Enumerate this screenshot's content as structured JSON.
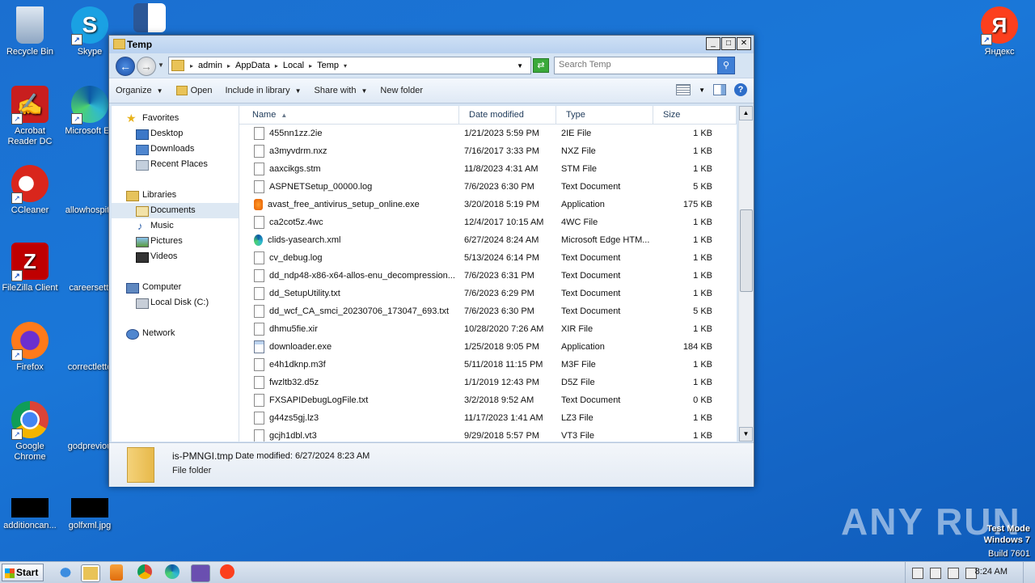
{
  "desktop": {
    "icons": [
      {
        "label": "Recycle Bin"
      },
      {
        "label": "Skype"
      },
      {
        "label": "Acrobat Reader DC"
      },
      {
        "label": "Microsoft Ed"
      },
      {
        "label": "CCleaner"
      },
      {
        "label": "allowhospita"
      },
      {
        "label": "FileZilla Client"
      },
      {
        "label": "careersetti"
      },
      {
        "label": "Firefox"
      },
      {
        "label": "correctlette"
      },
      {
        "label": "Google Chrome"
      },
      {
        "label": "godpreviou"
      },
      {
        "label": "additioncan..."
      },
      {
        "label": "golfxml.jpg"
      },
      {
        "label": "Яндекс"
      }
    ],
    "watermark": {
      "line1": "Test Mode",
      "line2": "Windows 7",
      "line3": "Build 7601"
    },
    "anyrun": "ANY RUN"
  },
  "window": {
    "title": "Temp",
    "breadcrumbs": [
      "admin",
      "AppData",
      "Local",
      "Temp"
    ],
    "search_placeholder": "Search Temp",
    "toolbar": {
      "organize": "Organize",
      "open": "Open",
      "include": "Include in library",
      "share": "Share with",
      "newfolder": "New folder"
    },
    "nav": {
      "favorites": "Favorites",
      "desktop": "Desktop",
      "downloads": "Downloads",
      "recent": "Recent Places",
      "libraries": "Libraries",
      "documents": "Documents",
      "music": "Music",
      "pictures": "Pictures",
      "videos": "Videos",
      "computer": "Computer",
      "localdisk": "Local Disk (C:)",
      "network": "Network"
    },
    "columns": {
      "name": "Name",
      "date": "Date modified",
      "type": "Type",
      "size": "Size"
    },
    "files": [
      {
        "name": "455nn1zz.2ie",
        "date": "1/21/2023 5:59 PM",
        "type": "2IE File",
        "size": "1 KB"
      },
      {
        "name": "a3myvdrm.nxz",
        "date": "7/16/2017 3:33 PM",
        "type": "NXZ File",
        "size": "1 KB"
      },
      {
        "name": "aaxcikgs.stm",
        "date": "11/8/2023 4:31 AM",
        "type": "STM File",
        "size": "1 KB"
      },
      {
        "name": "ASPNETSetup_00000.log",
        "date": "7/6/2023 6:30 PM",
        "type": "Text Document",
        "size": "5 KB"
      },
      {
        "name": "avast_free_antivirus_setup_online.exe",
        "date": "3/20/2018 5:19 PM",
        "type": "Application",
        "size": "175 KB"
      },
      {
        "name": "ca2cot5z.4wc",
        "date": "12/4/2017 10:15 AM",
        "type": "4WC File",
        "size": "1 KB"
      },
      {
        "name": "clids-yasearch.xml",
        "date": "6/27/2024 8:24 AM",
        "type": "Microsoft Edge HTM...",
        "size": "1 KB"
      },
      {
        "name": "cv_debug.log",
        "date": "5/13/2024 6:14 PM",
        "type": "Text Document",
        "size": "1 KB"
      },
      {
        "name": "dd_ndp48-x86-x64-allos-enu_decompression...",
        "date": "7/6/2023 6:31 PM",
        "type": "Text Document",
        "size": "1 KB"
      },
      {
        "name": "dd_SetupUtility.txt",
        "date": "7/6/2023 6:29 PM",
        "type": "Text Document",
        "size": "1 KB"
      },
      {
        "name": "dd_wcf_CA_smci_20230706_173047_693.txt",
        "date": "7/6/2023 6:30 PM",
        "type": "Text Document",
        "size": "5 KB"
      },
      {
        "name": "dhmu5fie.xir",
        "date": "10/28/2020 7:26 AM",
        "type": "XIR File",
        "size": "1 KB"
      },
      {
        "name": "downloader.exe",
        "date": "1/25/2018 9:05 PM",
        "type": "Application",
        "size": "184 KB"
      },
      {
        "name": "e4h1dknp.m3f",
        "date": "5/11/2018 11:15 PM",
        "type": "M3F File",
        "size": "1 KB"
      },
      {
        "name": "fwzltb32.d5z",
        "date": "1/1/2019 12:43 PM",
        "type": "D5Z File",
        "size": "1 KB"
      },
      {
        "name": "FXSAPIDebugLogFile.txt",
        "date": "3/2/2018 9:52 AM",
        "type": "Text Document",
        "size": "0 KB"
      },
      {
        "name": "g44zs5gj.lz3",
        "date": "11/17/2023 1:41 AM",
        "type": "LZ3 File",
        "size": "1 KB"
      },
      {
        "name": "gcjh1dbl.vt3",
        "date": "9/29/2018 5:57 PM",
        "type": "VT3 File",
        "size": "1 KB"
      }
    ],
    "details": {
      "name": "is-PMNGI.tmp",
      "modified": "Date modified: 6/27/2024 8:23 AM",
      "type": "File folder"
    }
  },
  "taskbar": {
    "start": "Start",
    "clock": "8:24 AM"
  }
}
